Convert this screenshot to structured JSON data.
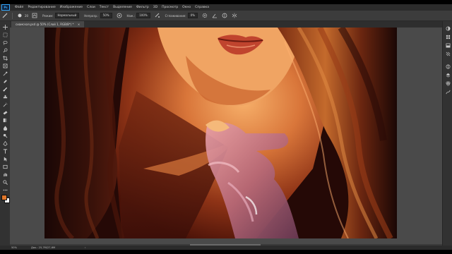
{
  "app": {
    "name": "Adobe Photoshop",
    "logo": "Ps"
  },
  "menu": [
    "Файл",
    "Редактирование",
    "Изображение",
    "Слои",
    "Текст",
    "Выделение",
    "Фильтр",
    "3D",
    "Просмотр",
    "Окно",
    "Справка"
  ],
  "options": {
    "brush_size": "20",
    "mode_label": "Режим:",
    "mode_value": "Нормальный",
    "opacity_label": "Непрозр.:",
    "opacity_value": "50%",
    "flow_label": "Наж.:",
    "flow_value": "100%",
    "smoothing_label": "Сглаживание:",
    "smoothing_value": "0%"
  },
  "document_tab": {
    "title": "сиамская.psd @ 50% (Слой 1, RGB/8*) *",
    "close": "×"
  },
  "status": {
    "zoom": "50%",
    "doc": "Док.: 25,7M/27,6M",
    "arrow": "›"
  },
  "colors": {
    "accent": "#31a8ff",
    "foreground": "#e0762a",
    "background": "#ffffff"
  },
  "icons": {
    "toolbar": [
      "move-icon",
      "marquee-icon",
      "lasso-icon",
      "quick-select-icon",
      "crop-icon",
      "frame-icon",
      "eyedropper-icon",
      "healing-icon",
      "brush-icon",
      "clone-stamp-icon",
      "history-brush-icon",
      "eraser-icon",
      "gradient-icon",
      "blur-icon",
      "dodge-icon",
      "pen-icon",
      "type-icon",
      "path-select-icon",
      "rectangle-icon",
      "hand-icon",
      "zoom-icon",
      "more-icon"
    ],
    "panels": [
      "color-icon",
      "swatches-icon",
      "gradients-icon",
      "patterns-icon",
      "adjustments-icon",
      "layers-icon",
      "channels-icon",
      "paths-icon"
    ]
  }
}
